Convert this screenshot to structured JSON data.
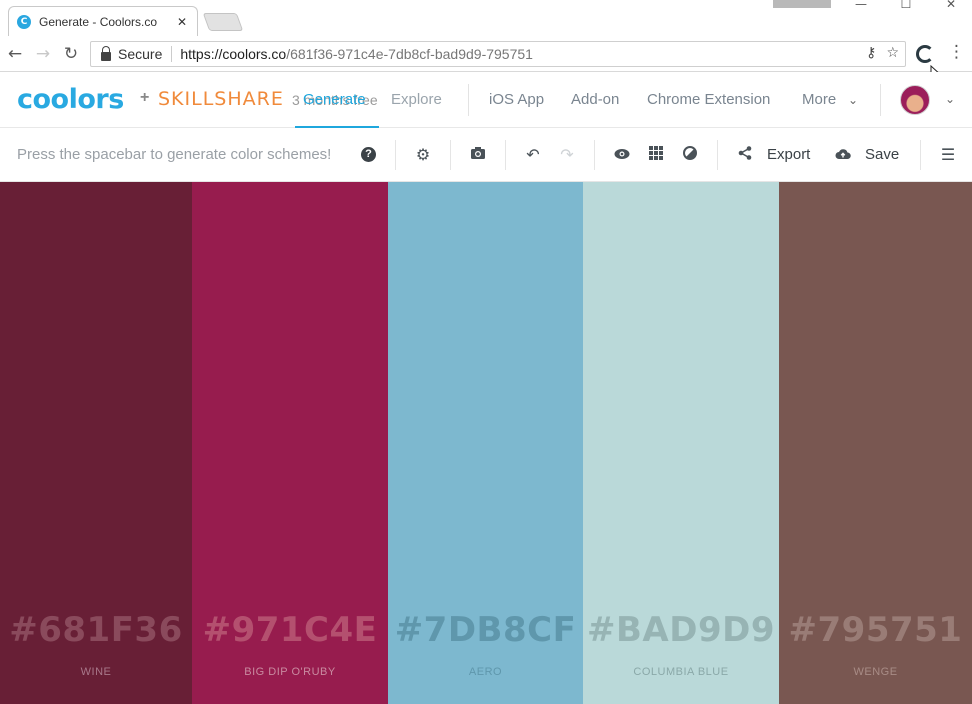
{
  "browser": {
    "tab_title": "Generate - Coolors.co",
    "tab_favicon": "C",
    "secure_label": "Secure",
    "url_host": "https://coolors.co",
    "url_path": "/681f36-971c4e-7db8cf-bad9d9-795751"
  },
  "header": {
    "logo_text": "coolors",
    "plus": "+",
    "partner": "SKILLSHARE",
    "promo": "3 months free",
    "nav": [
      "Generate",
      "Explore",
      "iOS App",
      "Add-on",
      "Chrome Extension",
      "More"
    ]
  },
  "toolbar": {
    "hint": "Press the spacebar to generate color schemes!",
    "help": "?",
    "export_label": "Export",
    "save_label": "Save"
  },
  "palette": [
    {
      "hex": "#681F36",
      "name": "WINE",
      "color": "#681F36",
      "text_color": "#8a4a5c",
      "name_color": "#a8788a"
    },
    {
      "hex": "#971C4E",
      "name": "BIG DIP O'RUBY",
      "color": "#971C4E",
      "text_color": "#b4506f",
      "name_color": "#c98aa0"
    },
    {
      "hex": "#7DB8CF",
      "name": "AERO",
      "color": "#7DB8CF",
      "text_color": "#5f97ac",
      "name_color": "#5f97ac"
    },
    {
      "hex": "#BAD9D9",
      "name": "COLUMBIA BLUE",
      "color": "#BAD9D9",
      "text_color": "#97b4b4",
      "name_color": "#8aa8a8"
    },
    {
      "hex": "#795751",
      "name": "WENGE",
      "color": "#795751",
      "text_color": "#997c76",
      "name_color": "#a88c86"
    }
  ]
}
